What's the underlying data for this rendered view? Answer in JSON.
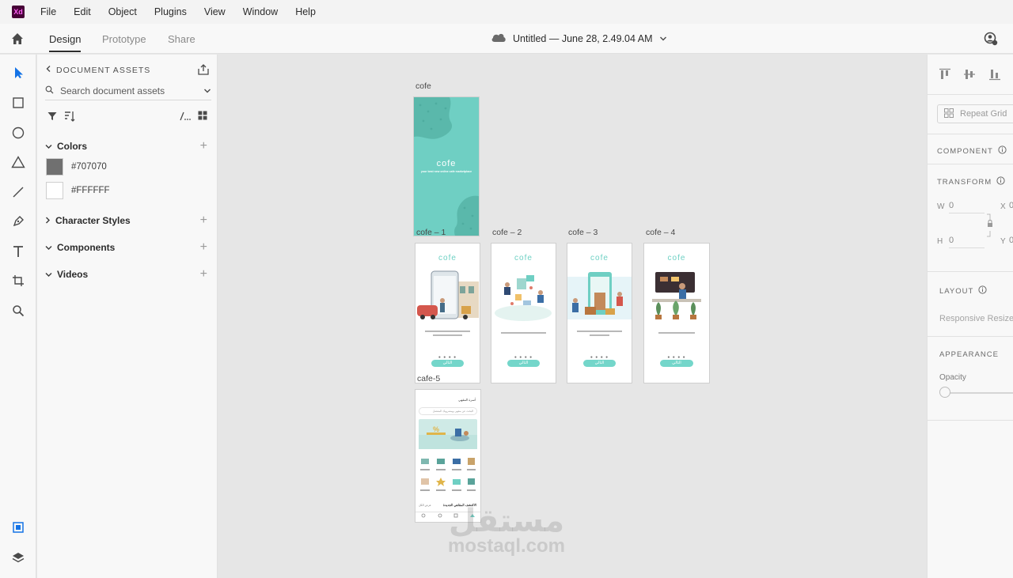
{
  "app": {
    "logo_text": "Xd"
  },
  "menu": {
    "items": [
      "File",
      "Edit",
      "Object",
      "Plugins",
      "View",
      "Window",
      "Help"
    ]
  },
  "toolbar": {
    "tabs": [
      {
        "label": "Design",
        "active": true
      },
      {
        "label": "Prototype",
        "active": false
      },
      {
        "label": "Share",
        "active": false
      }
    ],
    "document_title": "Untitled — June 28, 2.49.04 AM"
  },
  "assets": {
    "header": "DOCUMENT ASSETS",
    "search_placeholder": "Search document assets",
    "colors_label": "Colors",
    "colors": [
      {
        "hex": "#707070",
        "label": "#707070"
      },
      {
        "hex": "#FFFFFF",
        "label": "#FFFFFF"
      }
    ],
    "character_styles_label": "Character Styles",
    "components_label": "Components",
    "videos_label": "Videos"
  },
  "canvas": {
    "artboards": [
      {
        "label": "cofe",
        "logo": "cofe",
        "tagline": "your best new online cafe marketplace"
      },
      {
        "label": "cofe – 1",
        "logo": "cofe"
      },
      {
        "label": "cofe – 2",
        "logo": "cofe"
      },
      {
        "label": "cofe – 3",
        "logo": "cofe"
      },
      {
        "label": "cofe – 4",
        "logo": "cofe"
      },
      {
        "label": "cafe-5"
      }
    ],
    "button_text": "التالي",
    "cafe5": {
      "header": "أسرة المقهي",
      "search": "البحث عن مقهى ومشروبك المفضل",
      "section": "الاكتشف المقاهي الجديدة",
      "more": "عرض الكل"
    },
    "watermark_ar": "مستقل",
    "watermark_en": "mostaql.com"
  },
  "props": {
    "repeat_grid": "Repeat Grid",
    "component": "COMPONENT",
    "transform": "TRANSFORM",
    "w_label": "W",
    "w_value": "0",
    "h_label": "H",
    "h_value": "0",
    "x_label": "X",
    "x_value": "0",
    "y_label": "Y",
    "y_value": "0",
    "layout": "LAYOUT",
    "responsive_resize": "Responsive Resize",
    "appearance": "APPEARANCE",
    "opacity": "Opacity"
  },
  "colors": {
    "teal": "#6fcfc3",
    "accent_blue": "#1473e6"
  }
}
